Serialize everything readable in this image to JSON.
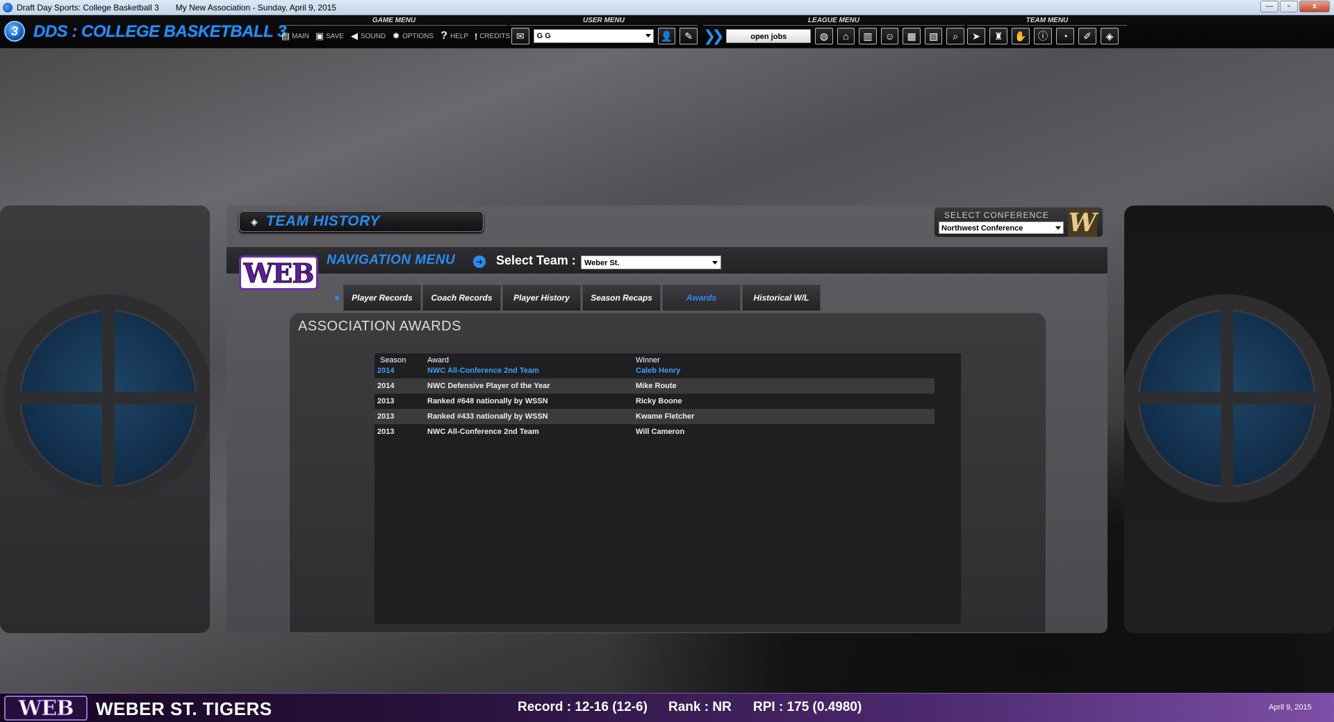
{
  "window": {
    "app_name": "Draft Day Sports: College Basketball 3",
    "association": "My New Association - Sunday, April 9, 2015",
    "minimize": "—",
    "maximize": "▫",
    "close": "x"
  },
  "header": {
    "badge": "3",
    "title": "DDS : COLLEGE BASKETBALL 3"
  },
  "game_menu": {
    "title": "GAME MENU",
    "items": [
      {
        "label": "MAIN",
        "icon": "main-icon"
      },
      {
        "label": "SAVE",
        "icon": "save-icon"
      },
      {
        "label": "SOUND",
        "icon": "sound-icon"
      },
      {
        "label": "OPTIONS",
        "icon": "options-icon"
      },
      {
        "label": "HELP",
        "icon": "help-icon"
      },
      {
        "label": "CREDITS",
        "icon": "credits-icon"
      }
    ]
  },
  "user_menu": {
    "title": "USER MENU",
    "user_value": "G G"
  },
  "league_menu": {
    "title": "LEAGUE MENU",
    "open_jobs_label": "open jobs"
  },
  "team_menu": {
    "title": "TEAM MENU"
  },
  "team_history": {
    "title": "TEAM HISTORY",
    "select_conference_label": "SELECT CONFERENCE",
    "conference_value": "Northwest Conference",
    "conference_logo": "W",
    "team_logo": "WEB",
    "nav_menu_label": "NAVIGATION MENU",
    "select_team_label": "Select Team :",
    "team_value": "Weber St.",
    "tabs": [
      {
        "label": "Player Records",
        "active": false
      },
      {
        "label": "Coach Records",
        "active": false
      },
      {
        "label": "Player History",
        "active": false
      },
      {
        "label": "Season Recaps",
        "active": false
      },
      {
        "label": "Awards",
        "active": true
      },
      {
        "label": "Historical W/L",
        "active": false
      }
    ]
  },
  "awards": {
    "title": "ASSOCIATION AWARDS",
    "columns": [
      "Season",
      "Award",
      "Winner"
    ],
    "rows": [
      {
        "season": "2014",
        "award": "NWC All-Conference 2nd Team",
        "winner": "Caleb Henry"
      },
      {
        "season": "2014",
        "award": "NWC Defensive Player of the Year",
        "winner": "Mike Route"
      },
      {
        "season": "2013",
        "award": "Ranked #648 nationally by WSSN",
        "winner": "Ricky Boone"
      },
      {
        "season": "2013",
        "award": "Ranked #433 nationally by WSSN",
        "winner": "Kwame Fletcher"
      },
      {
        "season": "2013",
        "award": "NWC All-Conference 2nd Team",
        "winner": "Will Cameron"
      }
    ]
  },
  "statusbar": {
    "logo": "WEB",
    "team_name": "WEBER ST. TIGERS",
    "record": "Record : 12-16 (12-6)",
    "rank": "Rank : NR",
    "rpi": "RPI : 175 (0.4980)",
    "date": "April 9, 2015"
  },
  "colors": {
    "accent_blue": "#2a8cf0",
    "team_purple": "#6d2fa8"
  }
}
